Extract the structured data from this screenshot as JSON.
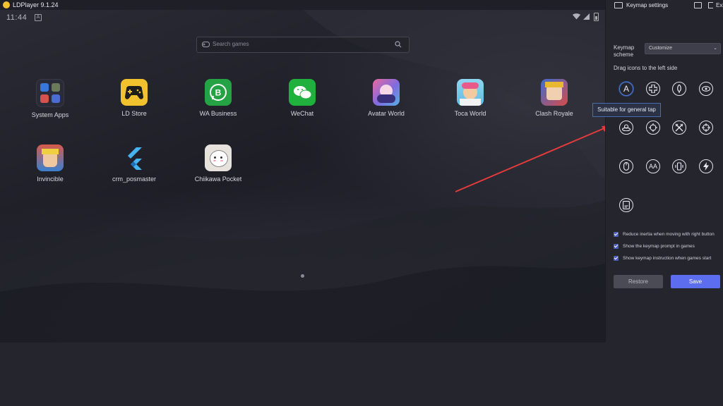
{
  "titlebar": {
    "title": "LDPlayer 9.1.24"
  },
  "status_bar": {
    "time": "11:44",
    "a_badge": "A"
  },
  "search": {
    "placeholder": "Search games"
  },
  "apps": [
    {
      "label": "System Apps",
      "icon": "system-apps-folder"
    },
    {
      "label": "LD Store",
      "icon": "ld-store-gamepad"
    },
    {
      "label": "WA Business",
      "icon": "whatsapp-business"
    },
    {
      "label": "WeChat",
      "icon": "wechat"
    },
    {
      "label": "Avatar World",
      "icon": "avatar-world"
    },
    {
      "label": "Toca World",
      "icon": "toca-world"
    },
    {
      "label": "Clash Royale",
      "icon": "clash-royale"
    },
    {
      "label": "Invincible",
      "icon": "invincible"
    },
    {
      "label": "crm_posmaster",
      "icon": "flutter"
    },
    {
      "label": "Chiikawa Pocket",
      "icon": "chiikawa-pocket"
    }
  ],
  "panel": {
    "title": "Keymap settings",
    "exit_label": "Exit",
    "scheme_label": "Keymap scheme",
    "scheme_value": "Customize",
    "drag_hint": "Drag icons to the left side",
    "tooltip": "Suitable for general tap",
    "tap_key_label": "A",
    "aa_key_label": "AA",
    "checkboxes": [
      {
        "label": "Reduce inertia when moving with right button",
        "checked": true
      },
      {
        "label": "Show the keymap prompt in games",
        "checked": true
      },
      {
        "label": "Show keymap instruction when games start",
        "checked": true
      }
    ],
    "restore_label": "Restore",
    "save_label": "Save"
  },
  "colors": {
    "accent": "#5d6df0",
    "annotation_arrow": "#e23b3b",
    "background": "#25252e"
  }
}
